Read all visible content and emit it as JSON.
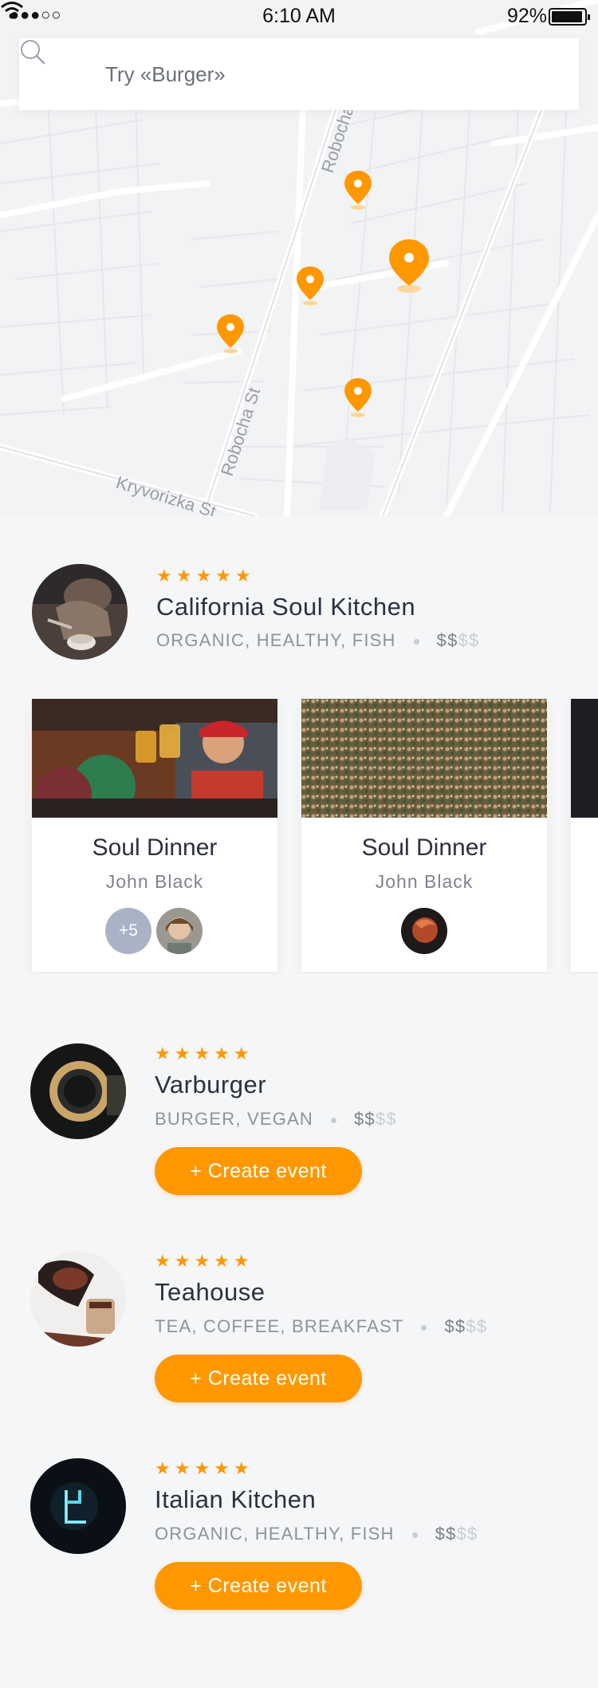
{
  "status_bar": {
    "signal": "●●●○○",
    "time": "6:10 AM",
    "battery": "92%"
  },
  "search": {
    "placeholder": "Try «Burger»"
  },
  "map": {
    "streets": [
      "Robocha",
      "Robocha St",
      "Kryvorizka St"
    ],
    "marker_color": "#ff9800"
  },
  "featured": {
    "rating": "★★★★★",
    "name": "California Soul Kitchen",
    "tags": "ORGANIC, HEALTHY, FISH",
    "price_active": "$$",
    "price_inactive": "$$"
  },
  "events": [
    {
      "title": "Soul Dinner",
      "host": "John Black",
      "extra_guests": "+5"
    },
    {
      "title": "Soul Dinner",
      "host": "John Black"
    }
  ],
  "restaurants": [
    {
      "rating": "★★★★★",
      "name": "Varburger",
      "tags": "BURGER, VEGAN",
      "price_active": "$$",
      "price_inactive": "$$",
      "button": "+ Create event"
    },
    {
      "rating": "★★★★★",
      "name": "Teahouse",
      "tags": "TEA, COFFEE, BREAKFAST",
      "price_active": "$$",
      "price_inactive": "$$",
      "button": "+ Create event"
    },
    {
      "rating": "★★★★★",
      "name": "Italian Kitchen",
      "tags": "ORGANIC, HEALTHY, FISH",
      "price_active": "$$",
      "price_inactive": "$$",
      "button": "+ Create event"
    }
  ],
  "colors": {
    "accent": "#ff9800",
    "background": "#f5f6f8",
    "text": "#2d3040"
  }
}
